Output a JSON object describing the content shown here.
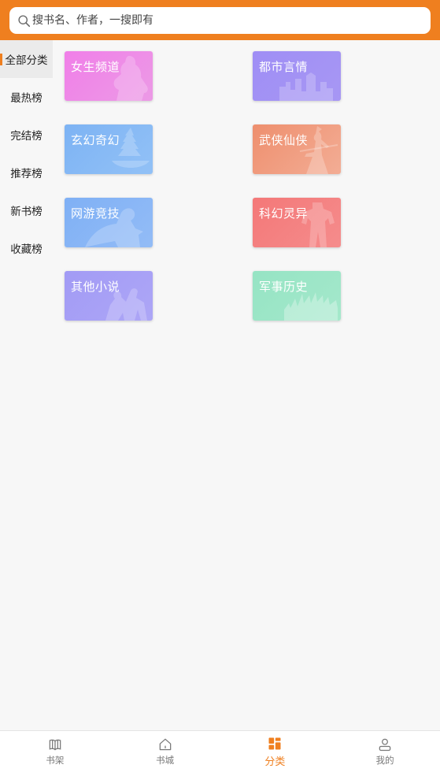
{
  "search": {
    "placeholder": "搜书名、作者，一搜即有"
  },
  "sidebar": {
    "items": [
      {
        "label": "全部分类",
        "active": true
      },
      {
        "label": "最热榜"
      },
      {
        "label": "完结榜"
      },
      {
        "label": "推荐榜"
      },
      {
        "label": "新书榜"
      },
      {
        "label": "收藏榜"
      }
    ]
  },
  "categories": [
    {
      "label": "女生频道",
      "color_start": "#f07fe8",
      "color_end": "#ec9ae6"
    },
    {
      "label": "都市言情",
      "color_start": "#9f8ef5",
      "color_end": "#a797f4"
    },
    {
      "label": "玄幻奇幻",
      "color_start": "#7db3f4",
      "color_end": "#92c1f6"
    },
    {
      "label": "武侠仙侠",
      "color_start": "#ee8f6e",
      "color_end": "#f3ad95"
    },
    {
      "label": "网游竞技",
      "color_start": "#7fb0f5",
      "color_end": "#93bcf6"
    },
    {
      "label": "科幻灵异",
      "color_start": "#f47878",
      "color_end": "#f58c8c"
    },
    {
      "label": "其他小说",
      "color_start": "#a29bf5",
      "color_end": "#ada6f6"
    },
    {
      "label": "军事历史",
      "color_start": "#96e4c4",
      "color_end": "#a4e8cb"
    }
  ],
  "tabbar": {
    "items": [
      {
        "label": "书架",
        "icon": "bookshelf-icon"
      },
      {
        "label": "书城",
        "icon": "home-icon"
      },
      {
        "label": "分类",
        "icon": "category-grid-icon",
        "active": true
      },
      {
        "label": "我的",
        "icon": "user-icon"
      }
    ]
  },
  "colors": {
    "accent": "#ef7f1f"
  }
}
